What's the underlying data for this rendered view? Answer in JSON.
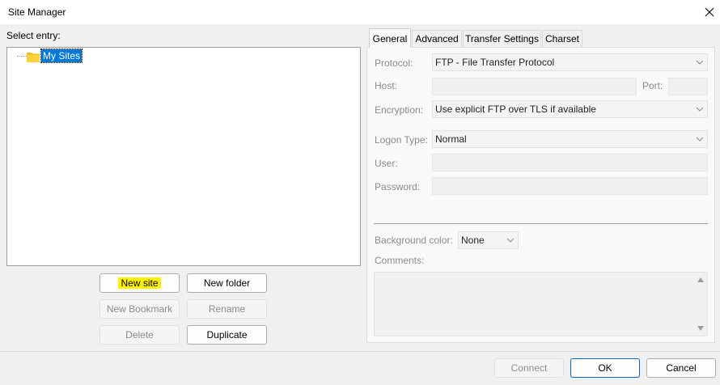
{
  "window": {
    "title": "Site Manager"
  },
  "tree": {
    "label": "Select entry:",
    "items": [
      {
        "label": "My Sites",
        "selected": true
      }
    ]
  },
  "buttons": {
    "new_site": "New site",
    "new_folder": "New folder",
    "new_bookmark": "New Bookmark",
    "rename": "Rename",
    "delete": "Delete",
    "duplicate": "Duplicate"
  },
  "tabs": [
    {
      "label": "General",
      "active": true
    },
    {
      "label": "Advanced"
    },
    {
      "label": "Transfer Settings"
    },
    {
      "label": "Charset"
    }
  ],
  "general": {
    "protocol_label": "Protocol:",
    "protocol_value": "FTP - File Transfer Protocol",
    "host_label": "Host:",
    "port_label": "Port:",
    "encryption_label": "Encryption:",
    "encryption_value": "Use explicit FTP over TLS if available",
    "logon_type_label": "Logon Type:",
    "logon_type_value": "Normal",
    "user_label": "User:",
    "password_label": "Password:",
    "background_color_label": "Background color:",
    "background_color_value": "None",
    "comments_label": "Comments:"
  },
  "footer": {
    "connect": "Connect",
    "ok": "OK",
    "cancel": "Cancel"
  },
  "colors": {
    "selection": "#0078d7",
    "highlight": "#fff200",
    "default_button_border": "#0067c0"
  },
  "icons": [
    "close-icon",
    "folder-icon",
    "chevron-down-icon",
    "scroll-up-icon",
    "scroll-down-icon"
  ]
}
